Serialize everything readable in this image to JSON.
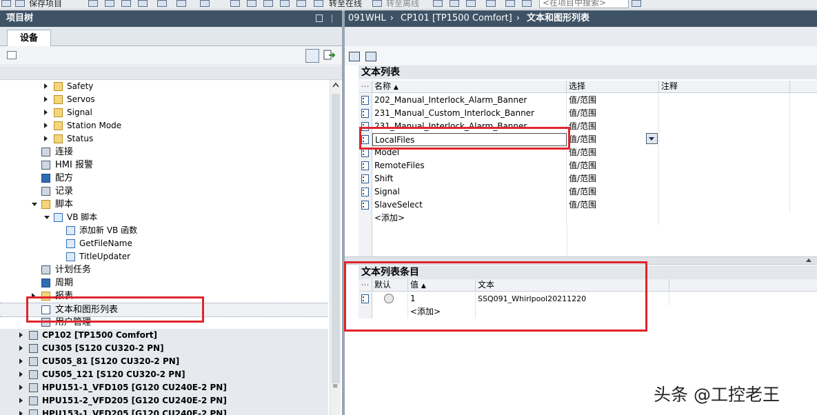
{
  "toolbar": {
    "save_project": "保存项目",
    "go_online": "转至在线",
    "go_offline": "转至离线",
    "search_placeholder": "<在项目中搜索>"
  },
  "project_tree": {
    "title": "项目树",
    "devices_tab": "设备",
    "items": [
      {
        "label": "Safety",
        "level": 3,
        "arrow": "right",
        "icon": "folder-icon"
      },
      {
        "label": "Servos",
        "level": 3,
        "arrow": "right",
        "icon": "folder-icon"
      },
      {
        "label": "Signal",
        "level": 3,
        "arrow": "right",
        "icon": "folder-icon"
      },
      {
        "label": "Station Mode",
        "level": 3,
        "arrow": "right",
        "icon": "folder-icon"
      },
      {
        "label": "Status",
        "level": 3,
        "arrow": "right",
        "icon": "folder-icon"
      },
      {
        "label": "连接",
        "level": 2,
        "arrow": "",
        "icon": "connection-icon"
      },
      {
        "label": "HMI 报警",
        "level": 2,
        "arrow": "",
        "icon": "alarm-icon"
      },
      {
        "label": "配方",
        "level": 2,
        "arrow": "",
        "icon": "recipe-icon"
      },
      {
        "label": "记录",
        "level": 2,
        "arrow": "",
        "icon": "log-icon"
      },
      {
        "label": "脚本",
        "level": 2,
        "arrow": "down",
        "icon": "script-icon"
      },
      {
        "label": "VB 脚本",
        "level": 3,
        "arrow": "down",
        "icon": "vb-folder-icon"
      },
      {
        "label": "添加新 VB 函数",
        "level": 4,
        "arrow": "",
        "icon": "add-vb-function-icon"
      },
      {
        "label": "GetFileName",
        "level": 4,
        "arrow": "",
        "icon": "vb-icon"
      },
      {
        "label": "TitleUpdater",
        "level": 4,
        "arrow": "",
        "icon": "vb-icon"
      },
      {
        "label": "计划任务",
        "level": 2,
        "arrow": "",
        "icon": "scheduler-icon"
      },
      {
        "label": "周期",
        "level": 2,
        "arrow": "",
        "icon": "cycle-icon"
      },
      {
        "label": "报表",
        "level": 2,
        "arrow": "right",
        "icon": "report-icon"
      },
      {
        "label": "文本和图形列表",
        "level": 2,
        "arrow": "",
        "icon": "text-graphic-list-icon",
        "selected": true
      },
      {
        "label": "用户管理",
        "level": 2,
        "arrow": "",
        "icon": "user-management-icon"
      }
    ],
    "devices": [
      "CP102 [TP1500 Comfort]",
      "CU305 [S120 CU320-2 PN]",
      "CU505_81 [S120 CU320-2 PN]",
      "CU505_121 [S120 CU320-2 PN]",
      "HPU151-1_VFD105 [G120 CU240E-2 PN]",
      "HPU151-2_VFD205 [G120 CU240E-2 PN]",
      "HPU153-1_VFD205 [G120 CU240E-2 PN]"
    ]
  },
  "breadcrumb": [
    "091WHL",
    "CP101 [TP1500 Comfort]",
    "文本和图形列表"
  ],
  "text_lists": {
    "title": "文本列表",
    "columns": [
      "名称",
      "选择",
      "注释"
    ],
    "rows": [
      {
        "name": "202_Manual_Interlock_Alarm_Banner",
        "selection": "值/范围",
        "comment": ""
      },
      {
        "name": "231_Manual_Custom_Interlock_Banner",
        "selection": "值/范围",
        "comment": ""
      },
      {
        "name": "231_Manual_Interlock_Alarm_Banner",
        "selection": "值/范围",
        "comment": ""
      },
      {
        "name": "LocalFiles",
        "selection": "值/范围",
        "comment": ""
      },
      {
        "name": "Model",
        "selection": "值/范围",
        "comment": ""
      },
      {
        "name": "RemoteFiles",
        "selection": "值/范围",
        "comment": ""
      },
      {
        "name": "Shift",
        "selection": "值/范围",
        "comment": ""
      },
      {
        "name": "Signal",
        "selection": "值/范围",
        "comment": ""
      },
      {
        "name": "SlaveSelect",
        "selection": "值/范围",
        "comment": ""
      }
    ],
    "add_label": "<添加>"
  },
  "text_list_entries": {
    "title": "文本列表条目",
    "columns": [
      "默认",
      "值",
      "文本"
    ],
    "rows": [
      {
        "default": false,
        "value": "1",
        "text": "SSQ091_Whirlpool20211220"
      }
    ],
    "add_label": "<添加>"
  },
  "watermark": "头条 @工控老王",
  "colors": {
    "title_bar": "#3f5366",
    "highlight_box": "#e0242c"
  }
}
